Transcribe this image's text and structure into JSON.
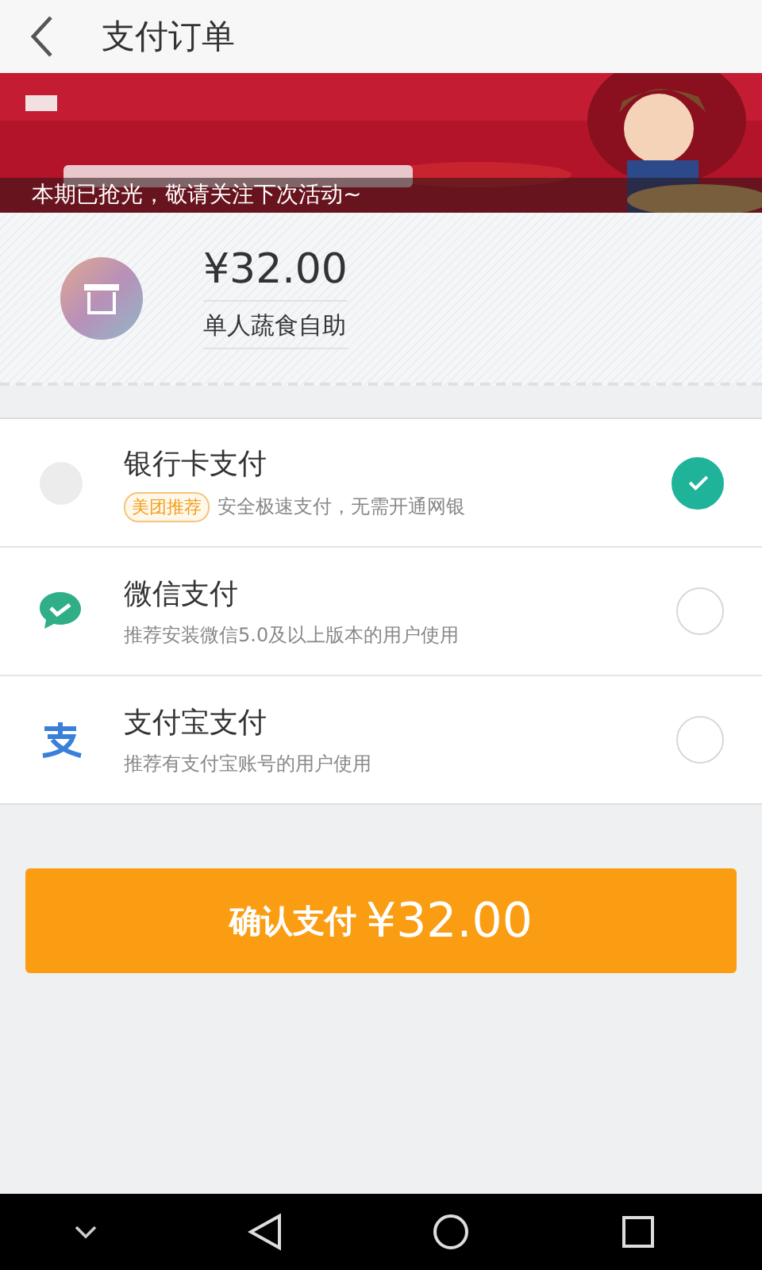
{
  "header": {
    "title": "支付订单"
  },
  "banner": {
    "kind": "picture",
    "caption": "本期已抢光，敬请关注下次活动~"
  },
  "order": {
    "price": "¥32.00",
    "name": "单人蔬食自助"
  },
  "methods": [
    {
      "kind": "bank",
      "title": "银行卡支付",
      "tag": "美团推荐",
      "desc": "安全极速支付，无需开通网银",
      "selected": true
    },
    {
      "kind": "wechat",
      "title": "微信支付",
      "desc": "推荐安装微信5.0及以上版本的用户使用",
      "selected": false
    },
    {
      "kind": "alipay",
      "title": "支付宝支付",
      "desc": "推荐有支付宝账号的用户使用",
      "selected": false
    }
  ],
  "confirm": {
    "label": "确认支付",
    "amount": "¥32.00"
  }
}
